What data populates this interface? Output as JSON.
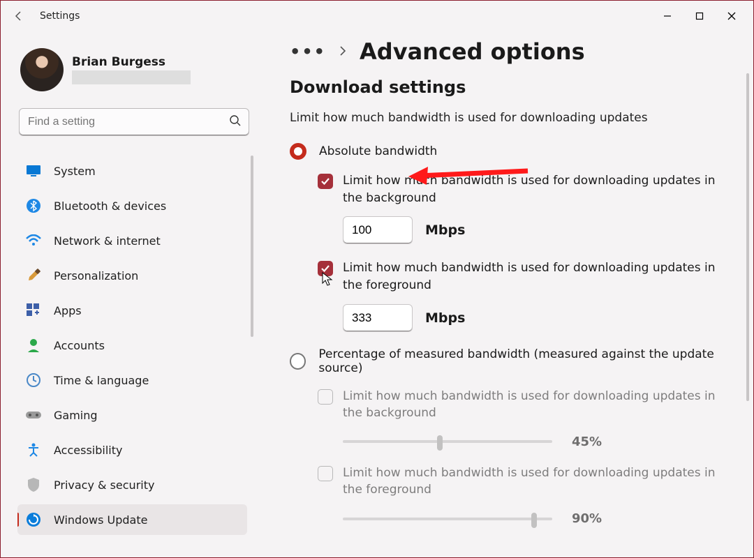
{
  "app_title": "Settings",
  "user": {
    "name": "Brian Burgess"
  },
  "search": {
    "placeholder": "Find a setting"
  },
  "sidebar": {
    "items": [
      {
        "label": "System"
      },
      {
        "label": "Bluetooth & devices"
      },
      {
        "label": "Network & internet"
      },
      {
        "label": "Personalization"
      },
      {
        "label": "Apps"
      },
      {
        "label": "Accounts"
      },
      {
        "label": "Time & language"
      },
      {
        "label": "Gaming"
      },
      {
        "label": "Accessibility"
      },
      {
        "label": "Privacy & security"
      },
      {
        "label": "Windows Update"
      }
    ]
  },
  "breadcrumb": {
    "page": "Advanced options"
  },
  "section": {
    "heading": "Download settings",
    "desc": "Limit how much bandwidth is used for downloading updates"
  },
  "radios": {
    "absolute": "Absolute bandwidth",
    "percentage": "Percentage of measured bandwidth (measured against the update source)"
  },
  "abs": {
    "bg_label": "Limit how much bandwidth is used for downloading updates in the background",
    "bg_value": "100",
    "fg_label": "Limit how much bandwidth is used for downloading updates in the foreground",
    "fg_value": "333",
    "unit": "Mbps"
  },
  "pct": {
    "bg_label": "Limit how much bandwidth is used for downloading updates in the background",
    "bg_value": "45%",
    "fg_label": "Limit how much bandwidth is used for downloading updates in the foreground",
    "fg_value": "90%"
  }
}
